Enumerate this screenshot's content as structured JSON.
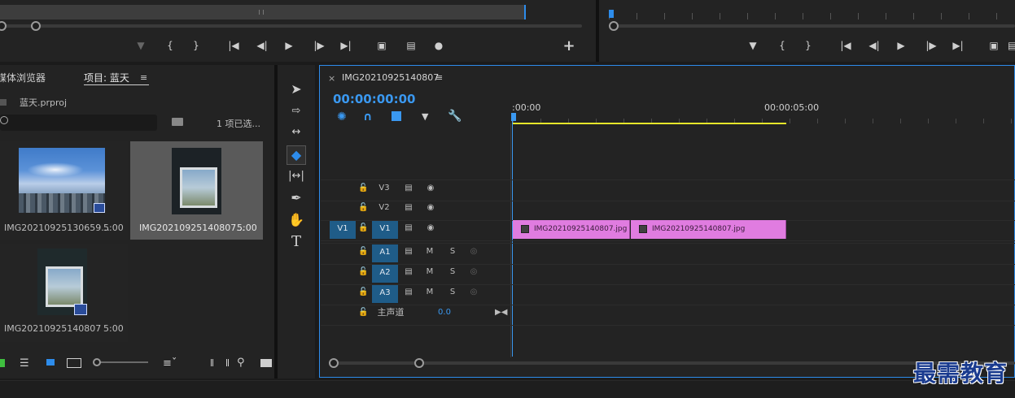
{
  "source_monitor": {
    "controls": [
      "marker",
      "{",
      "}",
      "go-in",
      "step-back",
      "play",
      "step-fwd",
      "go-out",
      "insert",
      "overwrite",
      "camera"
    ],
    "add": "+"
  },
  "program_monitor": {
    "controls": [
      "marker",
      "{",
      "}",
      "go-in",
      "step-back",
      "play",
      "step-fwd",
      "go-out",
      "lift"
    ]
  },
  "project_panel": {
    "tabs": [
      "媒体浏览器",
      "项目: 蓝天"
    ],
    "project_file": "蓝天.prproj",
    "selection_status": "1 项已选...",
    "items": [
      {
        "name": "IMG20210925130659...",
        "duration": "5:00"
      },
      {
        "name": "IMG20210925140807...",
        "duration": "5:00"
      },
      {
        "name": "IMG20210925140807",
        "duration": "5:00"
      }
    ]
  },
  "timeline": {
    "sequence_name": "IMG20210925140807",
    "timecode": "00:00:00:00",
    "ruler": [
      ":00:00",
      "00:00:05:00"
    ],
    "video_tracks": [
      {
        "label": "V3",
        "source": ""
      },
      {
        "label": "V2",
        "source": ""
      },
      {
        "label": "V1",
        "source": "V1"
      }
    ],
    "audio_tracks": [
      {
        "label": "A1",
        "m": "M",
        "s": "S"
      },
      {
        "label": "A2",
        "m": "M",
        "s": "S"
      },
      {
        "label": "A3",
        "m": "M",
        "s": "S"
      }
    ],
    "master": {
      "label": "主声道",
      "value": "0.0"
    },
    "clips": [
      {
        "name": "IMG20210925140807.jpg"
      },
      {
        "name": "IMG20210925140807.jpg"
      }
    ]
  },
  "watermark": "最需教育"
}
